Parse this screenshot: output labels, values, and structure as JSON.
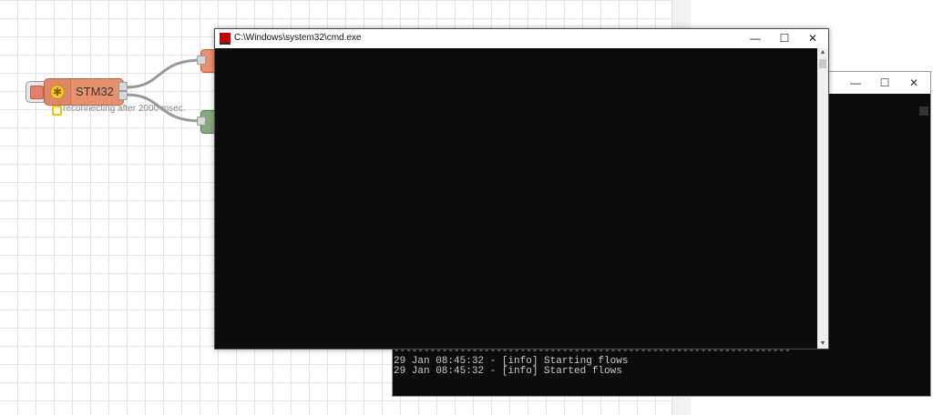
{
  "flow": {
    "node_label": "STM32",
    "status_text": "reconnecting after 2000 msec.",
    "status_color": "#f0c400",
    "node_color": "#e7916e"
  },
  "cmd_window": {
    "title": "C:\\Windows\\system32\\cmd.exe",
    "minimize_glyph": "—",
    "maximize_glyph": "☐",
    "close_glyph": "✕",
    "scroll_up": "▲",
    "scroll_down": "▼"
  },
  "back_window": {
    "minimize_glyph": "—",
    "maximize_glyph": "☐",
    "close_glyph": "✕",
    "separator": "------------------------------------------------------------------",
    "lines": [
      "29 Jan 08:45:32 - [info] Starting flows",
      "29 Jan 08:45:32 - [info] Started flows"
    ]
  }
}
